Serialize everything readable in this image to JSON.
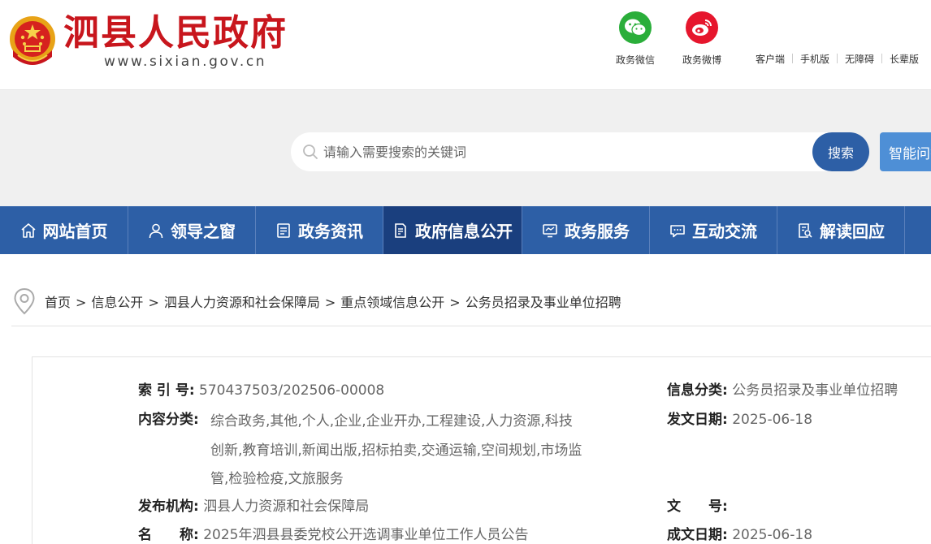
{
  "header": {
    "site_title": "泗县人民政府",
    "site_url": "www.sixian.gov.cn",
    "social": [
      {
        "label": "政务微信",
        "icon": "wechat-icon",
        "color": "#2aae3a"
      },
      {
        "label": "政务微博",
        "icon": "weibo-icon",
        "color": "#e6162d"
      }
    ],
    "top_links": [
      "客户端",
      "手机版",
      "无障碍",
      "长辈版"
    ]
  },
  "search": {
    "placeholder": "请输入需要搜索的关键词",
    "button_label": "搜索",
    "ai_button_label": "智能问答"
  },
  "nav": {
    "items": [
      {
        "label": "网站首页",
        "icon": "home-icon"
      },
      {
        "label": "领导之窗",
        "icon": "user-icon"
      },
      {
        "label": "政务资讯",
        "icon": "document-icon"
      },
      {
        "label": "政府信息公开",
        "icon": "file-list-icon",
        "active": true
      },
      {
        "label": "政务服务",
        "icon": "monitor-icon"
      },
      {
        "label": "互动交流",
        "icon": "chat-icon"
      },
      {
        "label": "解读回应",
        "icon": "file-search-icon"
      },
      {
        "label": "",
        "icon": "screen-icon"
      }
    ]
  },
  "breadcrumb": [
    "首页",
    "信息公开",
    "泗县人力资源和社会保障局",
    "重点领域信息公开",
    "公务员招录及事业单位招聘"
  ],
  "info": {
    "index_no_label": "索 引 号:",
    "index_no": "570437503/202506-00008",
    "category_label": "信息分类:",
    "category": "公务员招录及事业单位招聘",
    "content_type_label": "内容分类:",
    "content_type": "综合政务,其他,个人,企业,企业开办,工程建设,人力资源,科技创新,教育培训,新闻出版,招标拍卖,交通运输,空间规划,市场监管,检验检疫,文旅服务",
    "issue_date_label": "发文日期:",
    "issue_date": "2025-06-18",
    "publisher_label": "发布机构:",
    "publisher": "泗县人力资源和社会保障局",
    "doc_no_label": "文　　号:",
    "doc_no": "",
    "name_label": "名　　称:",
    "name": "2025年泗县县委党校公开选调事业单位工作人员公告",
    "created_date_label": "成文日期:",
    "created_date": "2025-06-18"
  },
  "colors": {
    "brand_red": "#c8161d",
    "nav_blue": "#2d5fa6",
    "nav_active": "#1a3f7e",
    "ai_blue": "#4e8fd6"
  }
}
